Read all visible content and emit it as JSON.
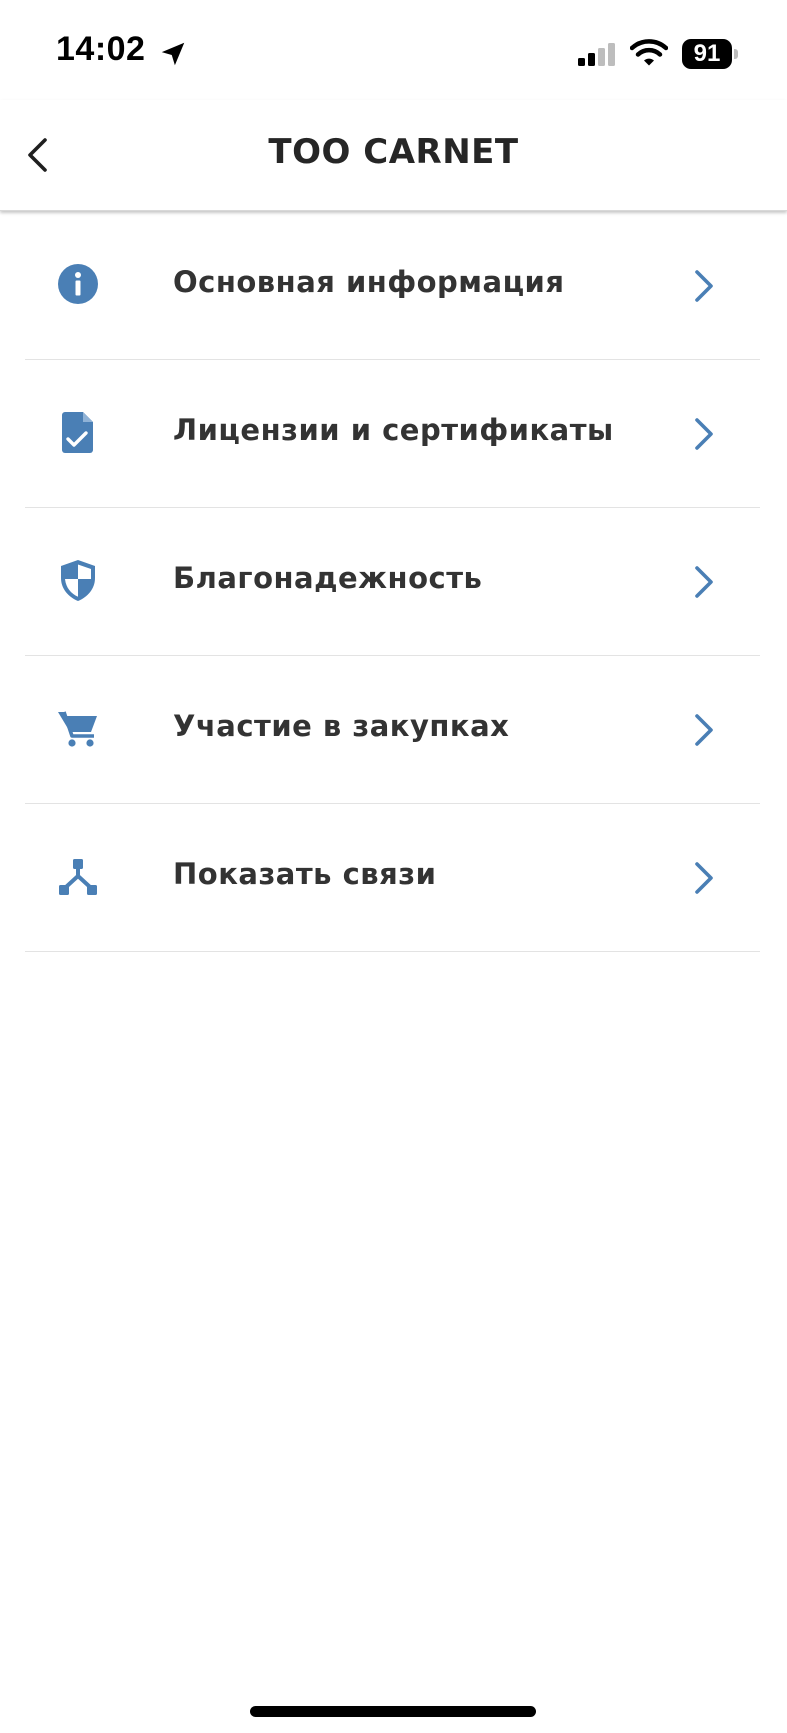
{
  "status_bar": {
    "time": "14:02",
    "battery": "91"
  },
  "nav": {
    "title": "ТОО CARNET"
  },
  "menu": [
    {
      "label": "Основная информация",
      "icon": "info-icon"
    },
    {
      "label": "Лицензии и сертификаты",
      "icon": "document-check-icon"
    },
    {
      "label": "Благонадежность",
      "icon": "shield-icon"
    },
    {
      "label": "Участие в закупках",
      "icon": "cart-icon"
    },
    {
      "label": "Показать связи",
      "icon": "connections-icon"
    }
  ],
  "colors": {
    "accent": "#4a7fb5",
    "divider": "#e3e3e3",
    "text": "#333333"
  }
}
